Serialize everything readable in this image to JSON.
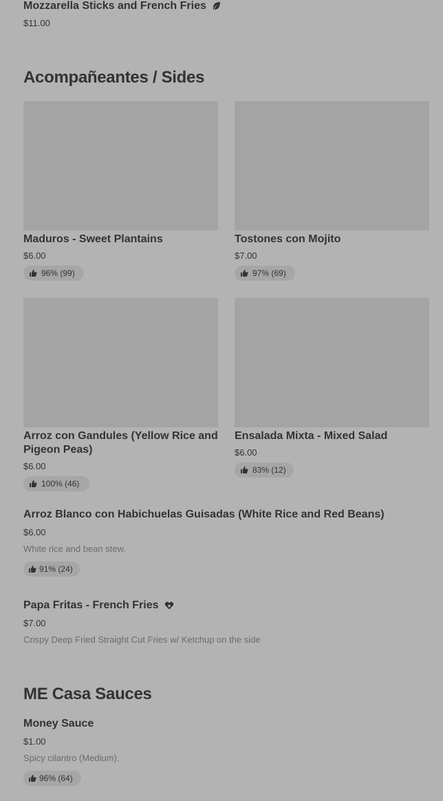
{
  "top_item": {
    "title": "Mozzarella Sticks and French Fries",
    "price": "$11.00",
    "icon": "leaf-icon"
  },
  "sides": {
    "title": "Acompañeantes / Sides",
    "cards": [
      {
        "title": "Maduros - Sweet Plantains",
        "price": "$6.00",
        "rating": "96% (99)"
      },
      {
        "title": "Tostones con Mojito",
        "price": "$7.00",
        "rating": "97% (69)"
      },
      {
        "title": "Arroz con Gandules (Yellow Rice and Pigeon Peas)",
        "price": "$6.00",
        "rating": "100% (46)"
      },
      {
        "title": "Ensalada Mixta - Mixed Salad",
        "price": "$6.00",
        "rating": "83% (12)"
      }
    ],
    "list": [
      {
        "title": "Arroz Blanco con Habichuelas Guisadas (White Rice and Red Beans)",
        "price": "$6.00",
        "description": "White rice and bean stew.",
        "rating": "91% (24)"
      },
      {
        "title": "Papa Fritas - French Fries",
        "price": "$7.00",
        "description": "Crispy Deep Fried Straight Cut Fries w/ Ketchup on the side",
        "icon": "heart-icon"
      }
    ]
  },
  "sauces": {
    "title": "ME Casa Sauces",
    "items": [
      {
        "title": "Money Sauce",
        "price": "$1.00",
        "description": "Spicy cilantro (Medium).",
        "rating": "96% (64)"
      }
    ]
  }
}
